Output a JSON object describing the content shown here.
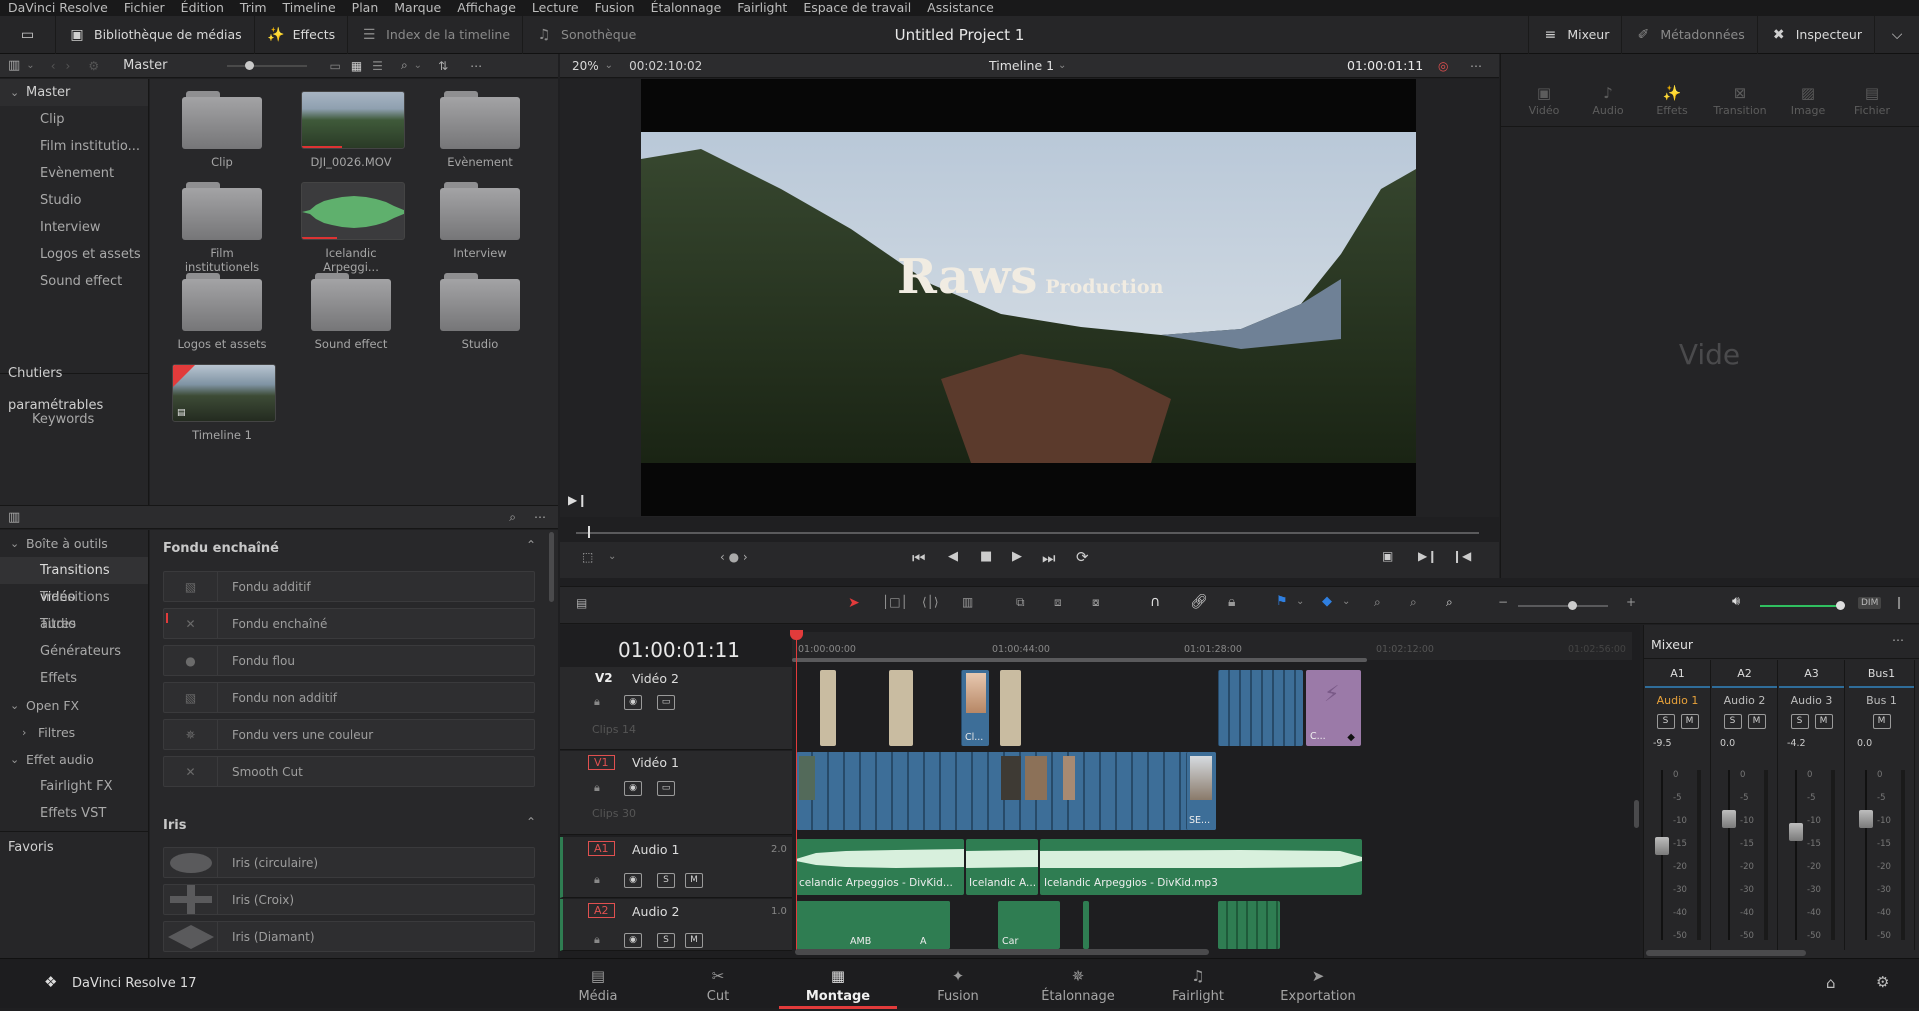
{
  "menu": [
    "DaVinci Resolve",
    "Fichier",
    "Édition",
    "Trim",
    "Timeline",
    "Plan",
    "Marque",
    "Affichage",
    "Lecture",
    "Fusion",
    "Étalonnage",
    "Fairlight",
    "Espace de travail",
    "Assistance"
  ],
  "toolbar": {
    "media_library": "Bibliothèque de médias",
    "effects": "Effects",
    "timeline_index": "Index de la timeline",
    "sound_library": "Sonothèque",
    "project_title": "Untitled Project 1",
    "mixer": "Mixeur",
    "metadata": "Métadonnées",
    "inspector": "Inspecteur"
  },
  "media_pool": {
    "header": "Master",
    "sidebar": {
      "master": "Master",
      "items": [
        "Clip",
        "Film institutio...",
        "Evènement",
        "Studio",
        "Interview",
        "Logos et assets",
        "Sound effect"
      ],
      "smart_bins": "Chutiers paramétrables",
      "keywords": "Keywords"
    },
    "bins": [
      {
        "label": "Clip",
        "kind": "folder"
      },
      {
        "label": "DJI_0026.MOV",
        "kind": "video"
      },
      {
        "label": "Evènement",
        "kind": "folder"
      },
      {
        "label": "Film institutionels",
        "kind": "folder"
      },
      {
        "label": "Icelandic Arpeggi...",
        "kind": "audio"
      },
      {
        "label": "Interview",
        "kind": "folder"
      },
      {
        "label": "Logos et assets",
        "kind": "folder"
      },
      {
        "label": "Sound effect",
        "kind": "folder"
      },
      {
        "label": "Studio",
        "kind": "folder"
      },
      {
        "label": "Timeline 1",
        "kind": "timeline"
      }
    ]
  },
  "effects_panel": {
    "tree": [
      {
        "label": "Boîte à outils",
        "level": 0,
        "expanded": true
      },
      {
        "label": "Transitions vidéo",
        "level": 1,
        "active": true
      },
      {
        "label": "Transitions audio",
        "level": 1
      },
      {
        "label": "Titres",
        "level": 1
      },
      {
        "label": "Générateurs",
        "level": 1
      },
      {
        "label": "Effets",
        "level": 1
      },
      {
        "label": "Open FX",
        "level": 0,
        "expanded": true
      },
      {
        "label": "Filtres",
        "level": 1,
        "collapsed": true
      },
      {
        "label": "Effet audio",
        "level": 0,
        "expanded": true
      },
      {
        "label": "Fairlight FX",
        "level": 1
      },
      {
        "label": "Effets VST",
        "level": 1
      }
    ],
    "favorites": "Favoris",
    "section1": "Fondu enchaîné",
    "dissolves": [
      "Fondu additif",
      "Fondu enchaîné",
      "Fondu flou",
      "Fondu non additif",
      "Fondu vers une couleur",
      "Smooth Cut"
    ],
    "section2": "Iris",
    "iris": [
      "Iris (circulaire)",
      "Iris (Croix)",
      "Iris (Diamant)"
    ]
  },
  "viewer": {
    "zoom": "20%",
    "duration": "00:02:10:02",
    "timeline_name": "Timeline 1",
    "timecode": "01:00:01:11",
    "title_main": "Raws",
    "title_sub": "Production"
  },
  "inspector": {
    "tabs": [
      "Vidéo",
      "Audio",
      "Effets",
      "Transition",
      "Image",
      "Fichier"
    ],
    "empty": "Vide"
  },
  "timeline": {
    "timecode": "01:00:01:11",
    "ruler": [
      "01:00:00:00",
      "01:00:44:00",
      "01:01:28:00",
      "01:02:12:00",
      "01:02:56:00"
    ],
    "tracks": [
      {
        "id": "V2",
        "name": "Vidéo 2",
        "count": "Clips 14"
      },
      {
        "id": "V1",
        "name": "Vidéo 1",
        "count": "Clips 30"
      },
      {
        "id": "A1",
        "name": "Audio 1",
        "level": "2.0"
      },
      {
        "id": "A2",
        "name": "Audio 2",
        "level": "1.0"
      }
    ],
    "clip_labels": {
      "v2_a": "Cl...",
      "v2_b": "C...",
      "v1_end": "SE...",
      "a1_1": "celandic Arpeggios - DivKid...",
      "a1_2": "Icelandic A...",
      "a1_3": "Icelandic Arpeggios - DivKid.mp3",
      "a2_1": "AMB",
      "a2_2": "A",
      "a2_3": "Car"
    },
    "solo": "S",
    "mute": "M"
  },
  "mixer": {
    "title": "Mixeur",
    "channels": [
      {
        "bus": "A1",
        "name": "Audio 1",
        "value": "-9.5",
        "level": 0.56
      },
      {
        "bus": "A2",
        "name": "Audio 2",
        "value": "0.0",
        "level": 0.72
      },
      {
        "bus": "A3",
        "name": "Audio 3",
        "value": "-4.2",
        "level": 0.64
      },
      {
        "bus": "Bus1",
        "name": "Bus 1",
        "value": "0.0",
        "level": 0.72
      }
    ],
    "scale": [
      "0",
      "-5",
      "-10",
      "-15",
      "-20",
      "-30",
      "-40",
      "-50"
    ],
    "dim": "DIM"
  },
  "pages": {
    "app": "DaVinci Resolve 17",
    "tabs": [
      "Média",
      "Cut",
      "Montage",
      "Fusion",
      "Étalonnage",
      "Fairlight",
      "Exportation"
    ],
    "active": "Montage"
  },
  "colors": {
    "accent_red": "#e23b3b",
    "video_clip": "#3d6e98",
    "audio_clip": "#2f7d52",
    "active_tab": "#e23b3b",
    "level_green": "#30c060"
  }
}
